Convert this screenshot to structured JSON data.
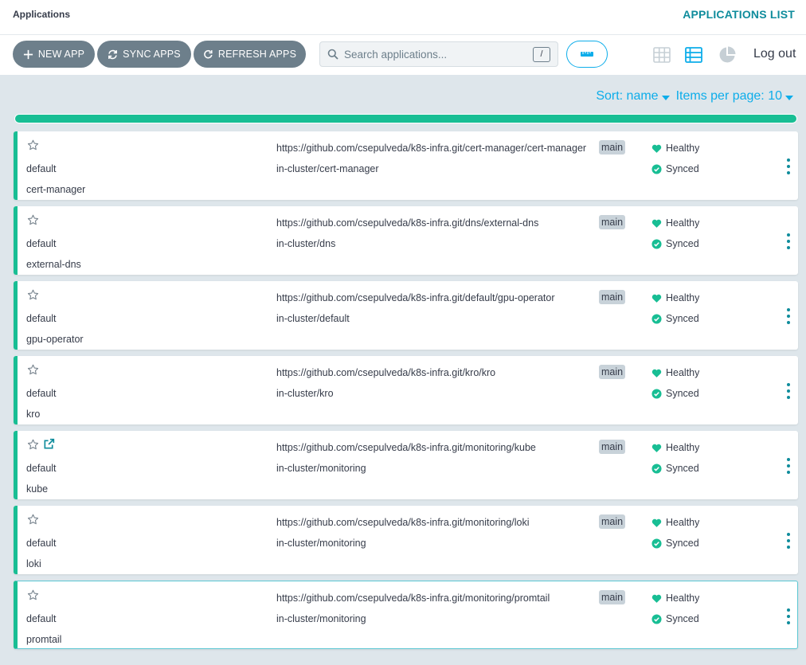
{
  "header": {
    "page_title": "Applications",
    "page_heading": "APPLICATIONS LIST"
  },
  "toolbar": {
    "new_app_label": "NEW APP",
    "sync_apps_label": "SYNC APPS",
    "refresh_apps_label": "REFRESH APPS",
    "search_placeholder": "Search applications...",
    "search_shortcut": "/",
    "view_icons": [
      "tiles-view-icon",
      "list-view-icon",
      "summary-pie-icon"
    ],
    "active_view": "list",
    "logout_label": "Log out"
  },
  "sort": {
    "sort_label": "Sort: name",
    "items_per_page_label": "Items per page: 10"
  },
  "progress": {
    "fraction": 1.0
  },
  "colors": {
    "accent": "#0dadea",
    "teal": "#0f8c9c",
    "healthy": "#18be94",
    "button": "#6d7f8b"
  },
  "apps": [
    {
      "project": "default",
      "name": "cert-manager",
      "repo": "https://github.com/csepulveda/k8s-infra.git/cert-manager/cert-manager",
      "branch": "main",
      "destination": "in-cluster/cert-manager",
      "health": "Healthy",
      "sync": "Synced",
      "external_link": false,
      "selected": false
    },
    {
      "project": "default",
      "name": "external-dns",
      "repo": "https://github.com/csepulveda/k8s-infra.git/dns/external-dns",
      "branch": "main",
      "destination": "in-cluster/dns",
      "health": "Healthy",
      "sync": "Synced",
      "external_link": false,
      "selected": false
    },
    {
      "project": "default",
      "name": "gpu-operator",
      "repo": "https://github.com/csepulveda/k8s-infra.git/default/gpu-operator",
      "branch": "main",
      "destination": "in-cluster/default",
      "health": "Healthy",
      "sync": "Synced",
      "external_link": false,
      "selected": false
    },
    {
      "project": "default",
      "name": "kro",
      "repo": "https://github.com/csepulveda/k8s-infra.git/kro/kro",
      "branch": "main",
      "destination": "in-cluster/kro",
      "health": "Healthy",
      "sync": "Synced",
      "external_link": false,
      "selected": false
    },
    {
      "project": "default",
      "name": "kube",
      "repo": "https://github.com/csepulveda/k8s-infra.git/monitoring/kube",
      "branch": "main",
      "destination": "in-cluster/monitoring",
      "health": "Healthy",
      "sync": "Synced",
      "external_link": true,
      "selected": false
    },
    {
      "project": "default",
      "name": "loki",
      "repo": "https://github.com/csepulveda/k8s-infra.git/monitoring/loki",
      "branch": "main",
      "destination": "in-cluster/monitoring",
      "health": "Healthy",
      "sync": "Synced",
      "external_link": false,
      "selected": false
    },
    {
      "project": "default",
      "name": "promtail",
      "repo": "https://github.com/csepulveda/k8s-infra.git/monitoring/promtail",
      "branch": "main",
      "destination": "in-cluster/monitoring",
      "health": "Healthy",
      "sync": "Synced",
      "external_link": false,
      "selected": true
    }
  ]
}
